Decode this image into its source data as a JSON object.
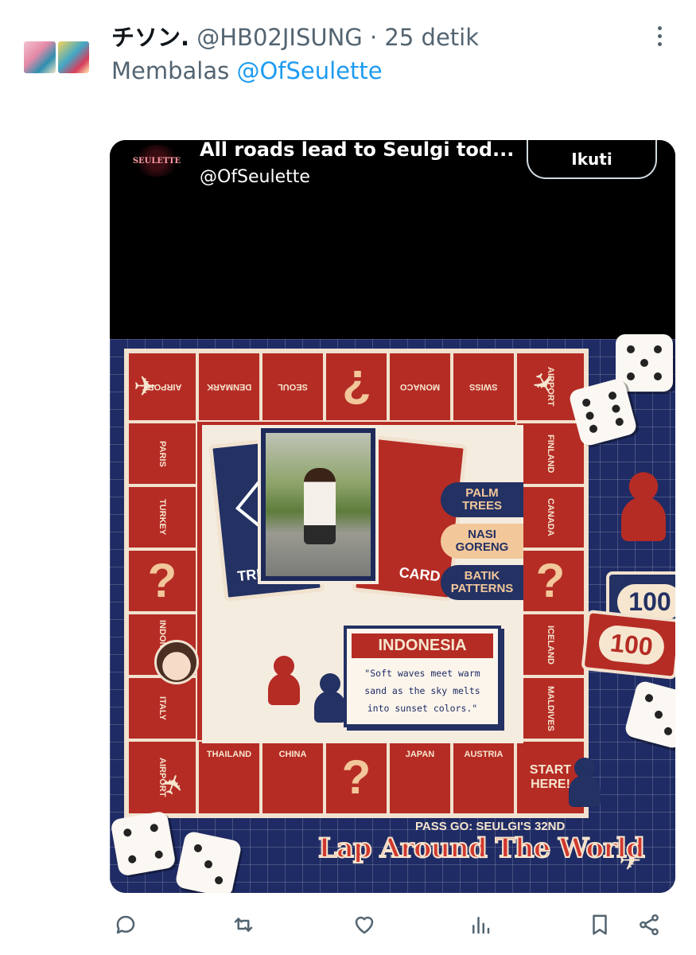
{
  "tweet": {
    "author_name": "チソン.",
    "author_handle": "@HB02JISUNG",
    "separator": " · ",
    "time": "25 detik",
    "reply_prefix": "Membalas ",
    "reply_to": "@OfSeulette"
  },
  "embed": {
    "logo_text": "SEULETTE",
    "title": "All roads lead to Seulgi tod...",
    "handle": "@OfSeulette",
    "follow_label": "Ikuti"
  },
  "board": {
    "top_cells": [
      "AIRPORT",
      "DENMARK",
      "SEOUL",
      "?",
      "MONACO",
      "SWISS",
      "AIRPORT"
    ],
    "left_cells": [
      "PARIS",
      "TURKEY",
      "?",
      "INDONESIA",
      "ITALY"
    ],
    "right_cells": [
      "FINLAND",
      "CANADA",
      "?",
      "ICELAND",
      "MALDIVES"
    ],
    "bottom_cells": [
      "AIRPORT",
      "THAILAND",
      "CHINA",
      "?",
      "JAPAN",
      "AUSTRIA",
      "START HERE!"
    ],
    "card_left_label": "TRE",
    "card_right_label": "CARD",
    "tags": [
      "PALM\nTREES",
      "NASI\nGORENG",
      "BATIK\nPATTERNS"
    ],
    "info_title": "INDONESIA",
    "info_text": "\"Soft waves meet warm sand as the sky melts into sunset colors.\"",
    "money_1": "100",
    "money_2": "100",
    "pass_go": "PASS GO: SEULGI'S 32ND",
    "logo_title": "Lap Around The World"
  },
  "icons": [
    "reply-icon",
    "retweet-icon",
    "like-icon",
    "views-icon",
    "bookmark-icon",
    "share-icon"
  ]
}
